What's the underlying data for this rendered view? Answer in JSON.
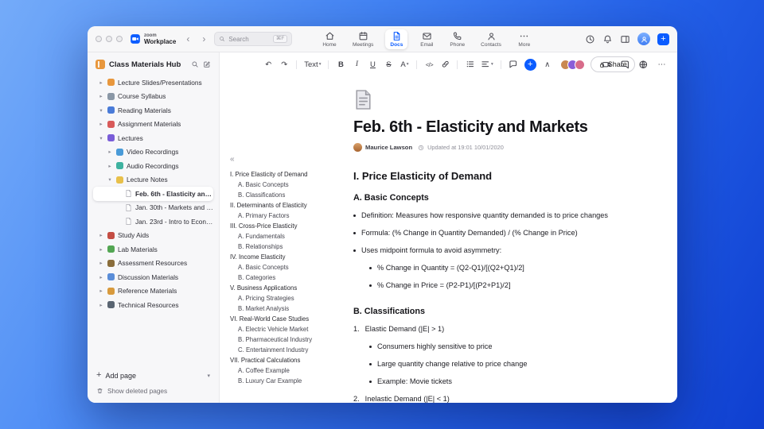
{
  "titlebar": {
    "brand_top": "zoom",
    "brand_bottom": "Workplace",
    "search": {
      "placeholder": "Search",
      "shortcut": "⌘F"
    },
    "tabs": [
      {
        "label": "Home",
        "icon": "home-icon",
        "active": false
      },
      {
        "label": "Meetings",
        "icon": "calendar-icon",
        "active": false
      },
      {
        "label": "Docs",
        "icon": "docs-icon",
        "active": true
      },
      {
        "label": "Email",
        "icon": "mail-icon",
        "active": false
      },
      {
        "label": "Phone",
        "icon": "phone-icon",
        "active": false
      },
      {
        "label": "Contacts",
        "icon": "contacts-icon",
        "active": false
      },
      {
        "label": "More",
        "icon": "more-icon",
        "active": false
      }
    ]
  },
  "sidebar": {
    "title": "Class Materials Hub",
    "items": [
      {
        "label": "Lecture Slides/Presentations",
        "level": 0,
        "chevron": "right",
        "icon": "slides-icon",
        "color": "#e8973d"
      },
      {
        "label": "Course Syllabus",
        "level": 0,
        "chevron": "right",
        "icon": "syllabus-icon",
        "color": "#8a97a6"
      },
      {
        "label": "Reading Materials",
        "level": 0,
        "chevron": "down",
        "icon": "reading-book-icon",
        "color": "#4a7bd8"
      },
      {
        "label": "Assignment Materials",
        "level": 0,
        "chevron": "right",
        "icon": "assignment-icon",
        "color": "#d85a5a"
      },
      {
        "label": "Lectures",
        "level": 0,
        "chevron": "down",
        "icon": "lectures-icon",
        "color": "#7a5dd8"
      },
      {
        "label": "Video Recordings",
        "level": 1,
        "chevron": "right",
        "icon": "video-icon",
        "color": "#4a9bd8"
      },
      {
        "label": "Audio Recordings",
        "level": 1,
        "chevron": "right",
        "icon": "audio-icon",
        "color": "#3fb2a0"
      },
      {
        "label": "Lecture Notes",
        "level": 1,
        "chevron": "down",
        "icon": "notes-icon",
        "color": "#e8c04a"
      },
      {
        "label": "Feb. 6th - Elasticity and M...",
        "level": 2,
        "type": "page",
        "selected": true
      },
      {
        "label": "Jan. 30th - Markets and P...",
        "level": 2,
        "type": "page"
      },
      {
        "label": "Jan. 23rd - Intro to Econo...",
        "level": 2,
        "type": "page"
      },
      {
        "label": "Study Aids",
        "level": 0,
        "chevron": "right",
        "icon": "study-aids-icon",
        "color": "#c44d44"
      },
      {
        "label": "Lab Materials",
        "level": 0,
        "chevron": "right",
        "icon": "lab-icon",
        "color": "#53a653"
      },
      {
        "label": "Assessment Resources",
        "level": 0,
        "chevron": "right",
        "icon": "assessment-icon",
        "color": "#8a6d3b"
      },
      {
        "label": "Discussion Materials",
        "level": 0,
        "chevron": "right",
        "icon": "discussion-icon",
        "color": "#5a8dd8"
      },
      {
        "label": "Reference Materials",
        "level": 0,
        "chevron": "right",
        "icon": "reference-icon",
        "color": "#d89a3d"
      },
      {
        "label": "Technical Resources",
        "level": 0,
        "chevron": "right",
        "icon": "technical-icon",
        "color": "#5a6572"
      }
    ],
    "footer": {
      "add_page": "Add page",
      "show_deleted": "Show deleted pages"
    }
  },
  "toolbar": {
    "buttons": [
      {
        "name": "undo-button",
        "label": "↶"
      },
      {
        "name": "redo-button",
        "label": "↷"
      },
      {
        "type": "divider"
      },
      {
        "name": "text-style-select",
        "label": "Text",
        "dropdown": true
      },
      {
        "type": "divider"
      },
      {
        "name": "bold-button",
        "label": "B"
      },
      {
        "name": "italic-button",
        "label": "I"
      },
      {
        "name": "underline-button",
        "label": "U"
      },
      {
        "name": "strikethrough-button",
        "label": "S"
      },
      {
        "name": "text-color-button",
        "label": "A",
        "dropdown": true
      },
      {
        "type": "divider"
      },
      {
        "name": "code-button",
        "label": "</>"
      },
      {
        "name": "link-button",
        "icon": "link-icon"
      },
      {
        "type": "divider"
      },
      {
        "name": "bulleted-list-button",
        "icon": "list-icon"
      },
      {
        "name": "align-button",
        "icon": "align-icon",
        "dropdown": true
      },
      {
        "type": "divider"
      },
      {
        "name": "comment-button",
        "icon": "comment-icon"
      },
      {
        "name": "insert-button",
        "label": "+",
        "accent": true
      },
      {
        "name": "collapse-toolbar-button",
        "label": "∧"
      }
    ],
    "share_label": "Share",
    "avatars": [
      "#c98850",
      "#8a5dd8",
      "#d86c8a"
    ],
    "right_buttons": [
      {
        "name": "start-meeting-button",
        "icon": "camera-icon"
      },
      {
        "name": "chat-button",
        "icon": "chat-icon"
      },
      {
        "name": "language-button",
        "icon": "globe-icon"
      },
      {
        "name": "more-options-button",
        "label": "⋯"
      }
    ]
  },
  "outline": {
    "collapse_glyph": "«",
    "items": [
      {
        "text": "I. Price Elasticity of Demand",
        "level": 0
      },
      {
        "text": "A. Basic Concepts",
        "level": 1
      },
      {
        "text": "B. Classifications",
        "level": 1
      },
      {
        "text": "II. Determinants of Elasticity",
        "level": 0
      },
      {
        "text": "A. Primary Factors",
        "level": 1
      },
      {
        "text": "III. Cross-Price Elasticity",
        "level": 0
      },
      {
        "text": "A. Fundamentals",
        "level": 1
      },
      {
        "text": "B. Relationships",
        "level": 1
      },
      {
        "text": "IV. Income Elasticity",
        "level": 0
      },
      {
        "text": "A. Basic Concepts",
        "level": 1
      },
      {
        "text": "B. Categories",
        "level": 1
      },
      {
        "text": "V. Business Applications",
        "level": 0
      },
      {
        "text": "A. Pricing Strategies",
        "level": 1
      },
      {
        "text": "B. Market Analysis",
        "level": 1
      },
      {
        "text": "VI. Real-World Case Studies",
        "level": 0
      },
      {
        "text": "A. Electric Vehicle Market",
        "level": 1
      },
      {
        "text": "B. Pharmaceutical Industry",
        "level": 1
      },
      {
        "text": "C. Entertainment Industry",
        "level": 1
      },
      {
        "text": "VII. Practical Calculations",
        "level": 0
      },
      {
        "text": "A. Coffee Example",
        "level": 1
      },
      {
        "text": "B. Luxury Car Example",
        "level": 1
      }
    ]
  },
  "doc": {
    "title": "Feb. 6th - Elasticity and Markets",
    "author": "Maurice Lawson",
    "updated": "Updated at 19:01 10/01/2020",
    "blocks": [
      {
        "type": "h2",
        "text": "I. Price Elasticity of Demand"
      },
      {
        "type": "h3",
        "text": "A. Basic Concepts"
      },
      {
        "type": "bullet",
        "level": 0,
        "text": "Definition: Measures how responsive quantity demanded is to price changes"
      },
      {
        "type": "bullet",
        "level": 0,
        "text": "Formula: (% Change in Quantity Demanded) / (% Change in Price)"
      },
      {
        "type": "bullet",
        "level": 0,
        "text": "Uses midpoint formula to avoid asymmetry:"
      },
      {
        "type": "bullet",
        "level": 1,
        "text": "% Change in Quantity = (Q2-Q1)/[(Q2+Q1)/2]"
      },
      {
        "type": "bullet",
        "level": 1,
        "text": "% Change in Price = (P2-P1)/[(P2+P1)/2]"
      },
      {
        "type": "h3",
        "text": "B. Classifications"
      },
      {
        "type": "number",
        "num": "1.",
        "text": "Elastic Demand (|E| > 1)"
      },
      {
        "type": "bullet",
        "level": 1,
        "text": "Consumers highly sensitive to price"
      },
      {
        "type": "bullet",
        "level": 1,
        "text": "Large quantity change relative to price change"
      },
      {
        "type": "bullet",
        "level": 1,
        "text": "Example: Movie tickets"
      },
      {
        "type": "number",
        "num": "2.",
        "text": "Inelastic Demand (|E| < 1)"
      }
    ]
  }
}
